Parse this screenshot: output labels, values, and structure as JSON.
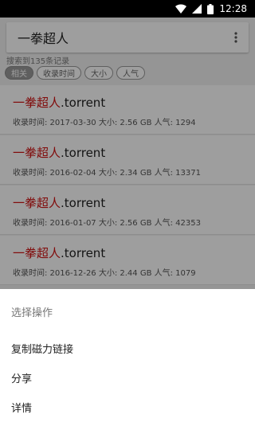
{
  "status_bar": {
    "time": "12:28"
  },
  "search": {
    "query": "一拳超人"
  },
  "result_count": "搜索到135条记录",
  "filters": [
    {
      "label": "相关",
      "active": true
    },
    {
      "label": "收录时间",
      "active": false
    },
    {
      "label": "大小",
      "active": false
    },
    {
      "label": "人气",
      "active": false
    }
  ],
  "results": [
    {
      "keyword": "一拳超人",
      "suffix": ".torrent",
      "meta": "收录时间: 2017-03-30 大小: 2.56 GB 人气: 1294"
    },
    {
      "keyword": "一拳超人",
      "suffix": ".torrent",
      "meta": "收录时间: 2016-02-04 大小: 2.34 GB 人气: 13371"
    },
    {
      "keyword": "一拳超人",
      "suffix": ".torrent",
      "meta": "收录时间: 2016-01-07 大小: 2.56 GB 人气: 42353"
    },
    {
      "keyword": "一拳超人",
      "suffix": ".torrent",
      "meta": "收录时间: 2016-12-26 大小: 2.44 GB 人气: 1079"
    }
  ],
  "sheet": {
    "title": "选择操作",
    "actions": [
      "复制磁力链接",
      "分享",
      "详情"
    ]
  },
  "colors": {
    "keyword": "#d11414",
    "active_chip": "#9a9a9a"
  }
}
